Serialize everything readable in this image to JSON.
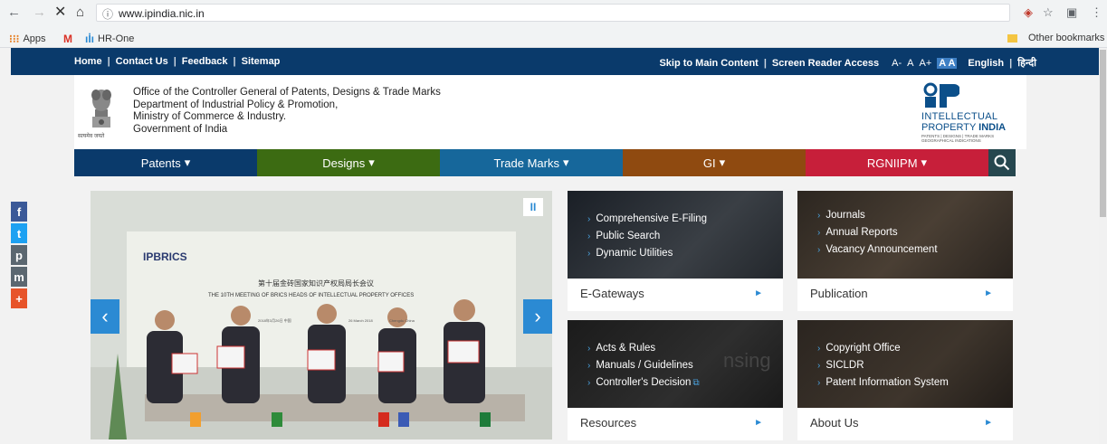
{
  "browser": {
    "url": "www.ipindia.nic.in",
    "bookmarks": [
      "Apps",
      "HR-One"
    ],
    "other_bookmarks": "Other bookmarks"
  },
  "topbar": {
    "left_links": [
      "Home",
      "Contact Us",
      "Feedback",
      "Sitemap"
    ],
    "skip": "Skip to Main Content",
    "screen_reader": "Screen Reader Access",
    "text_sizes": [
      "A-",
      "A",
      "A+"
    ],
    "contrast": "A A",
    "lang_en": "English",
    "lang_hi": "हिन्दी"
  },
  "header": {
    "office_lines": [
      "Office of the Controller General of Patents, Designs & Trade Marks",
      "Department of Industrial Policy & Promotion,",
      "Ministry of Commerce & Industry.",
      "Government of India"
    ],
    "emblem_caption": "सत्यमेव जयते",
    "logo_line1": "INTELLECTUAL",
    "logo_line2a": "PROPERTY ",
    "logo_line2b": "INDIA",
    "logo_line3": "PATENTS | DESIGNS | TRADE MARKS GEOGRAPHICAL INDICATIONS"
  },
  "menu": [
    {
      "label": "Patents",
      "color": "#0a3a6b",
      "width": 202
    },
    {
      "label": "Designs",
      "color": "#3c6b12",
      "width": 202
    },
    {
      "label": "Trade Marks",
      "color": "#16679b",
      "width": 202
    },
    {
      "label": "GI",
      "color": "#8f4a10",
      "width": 202
    },
    {
      "label": "RGNIIPM",
      "color": "#c71f3a",
      "width": 202
    }
  ],
  "carousel": {
    "banner_brand": "IPBRICS",
    "banner_cn": "第十届金砖国家知识产权局局长会议",
    "banner_en": "THE 10TH MEETING OF BRICS HEADS OF INTELLECTUAL PROPERTY OFFICES",
    "banner_date1": "2018年3月26日 中国",
    "banner_date2": "26 March 2018",
    "banner_place": "Chengdu China",
    "prev": "‹",
    "next": "›",
    "pause": "II"
  },
  "social": [
    "f",
    "t",
    "p",
    "m",
    "+"
  ],
  "tiles": {
    "egateways": {
      "title": "E-Gateways",
      "links": [
        "Comprehensive E-Filing",
        "Public Search",
        "Dynamic Utilities"
      ]
    },
    "publication": {
      "title": "Publication",
      "links": [
        "Journals",
        "Annual Reports",
        "Vacancy Announcement"
      ]
    },
    "resources": {
      "title": "Resources",
      "links": [
        "Acts & Rules",
        "Manuals / Guidelines",
        "Controller's Decision"
      ],
      "bg_text": "nsing"
    },
    "about": {
      "title": "About Us",
      "links": [
        "Copyright Office",
        "SICLDR",
        "Patent Information System"
      ]
    }
  },
  "colors": {
    "accent": "#2b8ad3",
    "topbar": "#0a3a6b"
  }
}
